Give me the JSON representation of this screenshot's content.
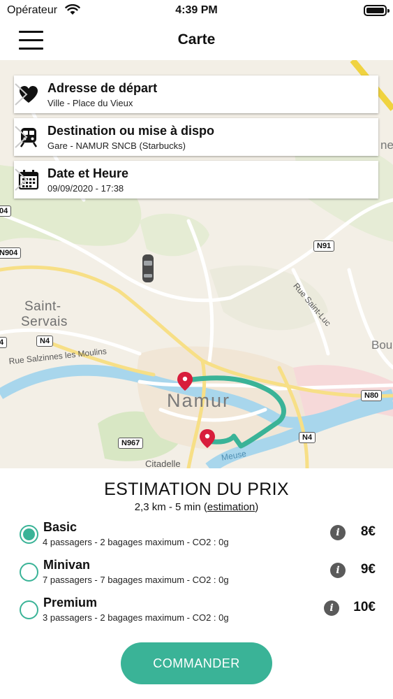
{
  "status_bar": {
    "carrier": "Opérateur",
    "time": "4:39 PM"
  },
  "nav": {
    "title": "Carte"
  },
  "map": {
    "labels": {
      "city": "Namur",
      "district_1": "Saint-",
      "district_2": "Servais",
      "street_1": "Rue Salzinnes les Moulins",
      "street_2": "Rue Saint-Luc",
      "citadel": "Citadelle",
      "river": "Meuse",
      "edge_right": "Bou",
      "edge_ne": "ne"
    },
    "road_badges": {
      "n91": "N91",
      "n904": "N904",
      "n4_west": "N4",
      "n80": "N80",
      "n4_east": "N4",
      "n967": "N967",
      "edge_a": "04",
      "edge_b": "4"
    },
    "route_color": "#3ab397",
    "pin_color": "#d81d3b"
  },
  "cards": {
    "departure": {
      "title": "Adresse de départ",
      "subtitle": "Ville - Place du Vieux"
    },
    "destination": {
      "title": "Destination ou mise à dispo",
      "subtitle": "Gare - NAMUR SNCB (Starbucks)"
    },
    "datetime": {
      "title": "Date et Heure",
      "subtitle": "09/09/2020 - 17:38"
    }
  },
  "estimation": {
    "title": "ESTIMATION DU PRIX",
    "summary": "2,3 km - 5 min",
    "link": "estimation",
    "options": [
      {
        "name": "Basic",
        "description": "4 passagers - 2 bagages maximum - CO2 : 0g",
        "price": "8€",
        "selected": true
      },
      {
        "name": "Minivan",
        "description": "7 passagers - 7 bagages maximum - CO2 : 0g",
        "price": "9€",
        "selected": false
      },
      {
        "name": "Premium",
        "description": "3 passagers - 2 bagages maximum - CO2 : 0g",
        "price": "10€",
        "selected": false
      }
    ]
  },
  "order_button": {
    "label": "COMMANDER"
  },
  "colors": {
    "accent": "#3ab397",
    "pin": "#d81d3b"
  }
}
